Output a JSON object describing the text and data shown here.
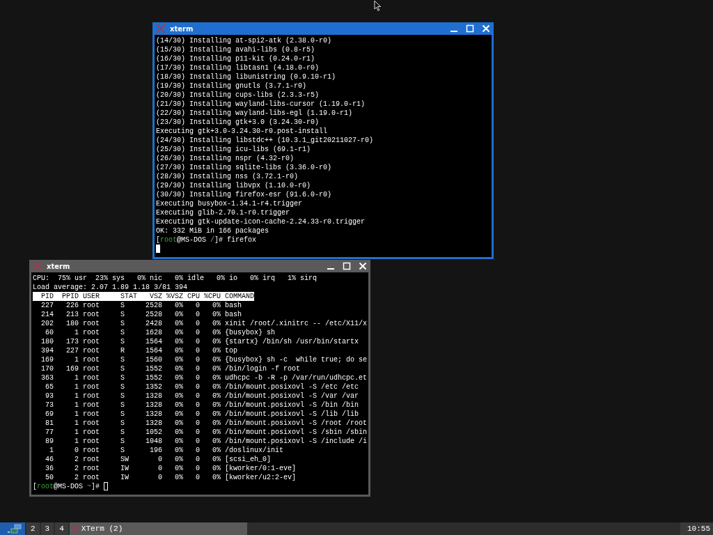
{
  "windows": [
    {
      "kind": "log",
      "title": "xterm",
      "active": true,
      "lines": [
        "(14/30) Installing at-spi2-atk (2.38.0-r0)",
        "(15/30) Installing avahi-libs (0.8-r5)",
        "(16/30) Installing p11-kit (0.24.0-r1)",
        "(17/30) Installing libtasn1 (4.18.0-r0)",
        "(18/30) Installing libunistring (0.9.10-r1)",
        "(19/30) Installing gnutls (3.7.1-r0)",
        "(20/30) Installing cups-libs (2.3.3-r5)",
        "(21/30) Installing wayland-libs-cursor (1.19.0-r1)",
        "(22/30) Installing wayland-libs-egl (1.19.0-r1)",
        "(23/30) Installing gtk+3.0 (3.24.30-r0)",
        "Executing gtk+3.0-3.24.30-r0.post-install",
        "(24/30) Installing libstdc++ (10.3.1_git20211027-r0)",
        "(25/30) Installing icu-libs (69.1-r1)",
        "(26/30) Installing nspr (4.32-r0)",
        "(27/30) Installing sqlite-libs (3.36.0-r0)",
        "(28/30) Installing nss (3.72.1-r0)",
        "(29/30) Installing libvpx (1.10.0-r0)",
        "(30/30) Installing firefox-esr (91.6.0-r0)",
        "Executing busybox-1.34.1-r4.trigger",
        "Executing glib-2.70.1-r0.trigger",
        "Executing gtk-update-icon-cache-2.24.33-r0.trigger",
        "OK: 332 MiB in 166 packages"
      ],
      "prompt": {
        "open": "[",
        "user": "root",
        "host": "@MS-DOS",
        "dir": "/",
        "close": "]#",
        "command": "firefox"
      }
    },
    {
      "kind": "top",
      "title": "xterm",
      "active": false,
      "lines": [
        "CPU:  75% usr  23% sys   0% nic   0% idle   0% io   0% irq   1% sirq",
        "Load average: 2.07 1.89 1.18 3/81 394"
      ],
      "columns": [
        "PID",
        "PPID",
        "USER",
        "STAT",
        "VSZ",
        "%VSZ",
        "CPU",
        "%CPU",
        "COMMAND"
      ],
      "rows": [
        [
          "227",
          "226",
          "root",
          "S",
          "2528",
          "0%",
          "0",
          "0%",
          "bash"
        ],
        [
          "214",
          "213",
          "root",
          "S",
          "2528",
          "0%",
          "0",
          "0%",
          "bash"
        ],
        [
          "202",
          "180",
          "root",
          "S",
          "2428",
          "0%",
          "0",
          "0%",
          "xinit /root/.xinitrc -- /etc/X11/x"
        ],
        [
          "60",
          "1",
          "root",
          "S",
          "1628",
          "0%",
          "0",
          "0%",
          "{busybox} sh"
        ],
        [
          "180",
          "173",
          "root",
          "S",
          "1564",
          "0%",
          "0",
          "0%",
          "{startx} /bin/sh /usr/bin/startx"
        ],
        [
          "394",
          "227",
          "root",
          "R",
          "1564",
          "0%",
          "0",
          "0%",
          "top"
        ],
        [
          "169",
          "1",
          "root",
          "S",
          "1560",
          "0%",
          "0",
          "0%",
          "{busybox} sh -c  while true; do se"
        ],
        [
          "170",
          "169",
          "root",
          "S",
          "1552",
          "0%",
          "0",
          "0%",
          "/bin/login -f root"
        ],
        [
          "363",
          "1",
          "root",
          "S",
          "1552",
          "0%",
          "0",
          "0%",
          "udhcpc -b -R -p /var/run/udhcpc.et"
        ],
        [
          "65",
          "1",
          "root",
          "S",
          "1352",
          "0%",
          "0",
          "0%",
          "/bin/mount.posixovl -S /etc /etc"
        ],
        [
          "93",
          "1",
          "root",
          "S",
          "1328",
          "0%",
          "0",
          "0%",
          "/bin/mount.posixovl -S /var /var"
        ],
        [
          "73",
          "1",
          "root",
          "S",
          "1328",
          "0%",
          "0",
          "0%",
          "/bin/mount.posixovl -S /bin /bin"
        ],
        [
          "69",
          "1",
          "root",
          "S",
          "1328",
          "0%",
          "0",
          "0%",
          "/bin/mount.posixovl -S /lib /lib"
        ],
        [
          "81",
          "1",
          "root",
          "S",
          "1328",
          "0%",
          "0",
          "0%",
          "/bin/mount.posixovl -S /root /root"
        ],
        [
          "77",
          "1",
          "root",
          "S",
          "1052",
          "0%",
          "0",
          "0%",
          "/bin/mount.posixovl -S /sbin /sbin"
        ],
        [
          "89",
          "1",
          "root",
          "S",
          "1048",
          "0%",
          "0",
          "0%",
          "/bin/mount.posixovl -S /include /i"
        ],
        [
          "1",
          "0",
          "root",
          "S",
          "196",
          "0%",
          "0",
          "0%",
          "/doslinux/init"
        ],
        [
          "46",
          "2",
          "root",
          "SW",
          "0",
          "0%",
          "0",
          "0%",
          "[scsi_eh_0]"
        ],
        [
          "36",
          "2",
          "root",
          "IW",
          "0",
          "0%",
          "0",
          "0%",
          "[kworker/0:1-eve]"
        ],
        [
          "50",
          "2",
          "root",
          "IW",
          "0",
          "0%",
          "0",
          "0%",
          "[kworker/u2:2-ev]"
        ]
      ],
      "prompt": {
        "open": "[",
        "user": "root",
        "host": "@MS-DOS",
        "dir": "~",
        "close": "]#"
      }
    }
  ],
  "taskbar": {
    "workspaces": [
      {
        "kind": "icon",
        "selected": true
      },
      {
        "kind": "number",
        "label": "2",
        "selected": false
      },
      {
        "kind": "number",
        "label": "3",
        "selected": false
      },
      {
        "kind": "number",
        "label": "4",
        "selected": false
      }
    ],
    "tasks": [
      {
        "label": "XTerm (2)"
      }
    ],
    "clock": "10:55"
  }
}
